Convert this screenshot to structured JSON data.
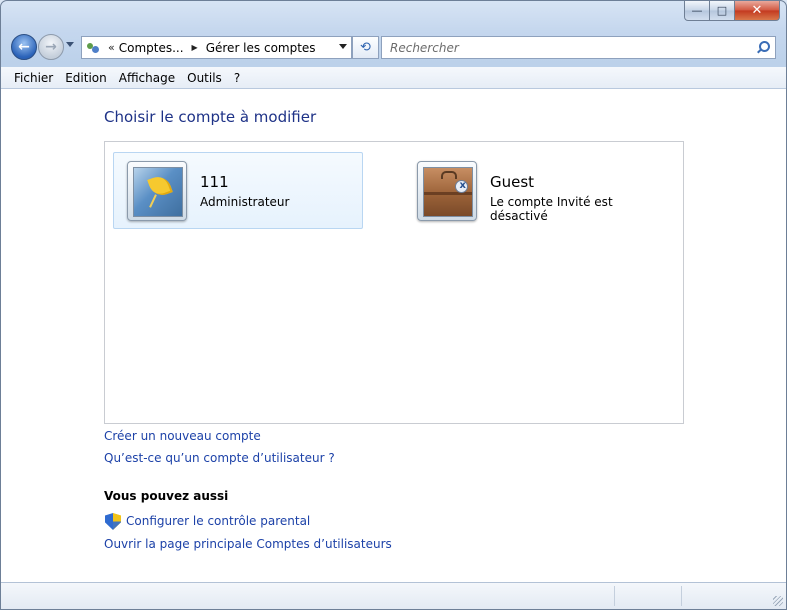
{
  "window": {
    "minimize_glyph": "—",
    "maximize_glyph": "□",
    "close_glyph": "✕"
  },
  "navigation": {
    "back_glyph": "←",
    "forward_glyph": "→",
    "breadcrumb_chevron": "«",
    "breadcrumb_parent": "Comptes...",
    "breadcrumb_separator": "▶",
    "breadcrumb_current": "Gérer les comptes",
    "refresh_glyph": "⟲",
    "search_placeholder": "Rechercher"
  },
  "menu": {
    "items": [
      "Fichier",
      "Edition",
      "Affichage",
      "Outils",
      "?"
    ]
  },
  "main": {
    "title": "Choisir le compte à modifier",
    "accounts": [
      {
        "name": "111",
        "role": "Administrateur",
        "avatar_icon": "yellow-leaf-avatar-icon",
        "selected": true
      },
      {
        "name": "Guest",
        "role": "Le compte Invité est désactivé",
        "avatar_icon": "briefcase-avatar-icon",
        "selected": false
      }
    ],
    "links": {
      "create_account": "Créer un nouveau compte",
      "what_is_account": "Qu’est-ce qu’un compte d’utilisateur ?"
    },
    "also_heading": "Vous pouvez aussi",
    "also_links": {
      "parental_control": "Configurer le contrôle parental",
      "user_accounts_home": "Ouvrir la page principale Comptes d’utilisateurs"
    }
  },
  "colors": {
    "title_blue": "#1e3287",
    "link_blue": "#1d42a8",
    "selected_tile_border": "#b9d6f2"
  }
}
